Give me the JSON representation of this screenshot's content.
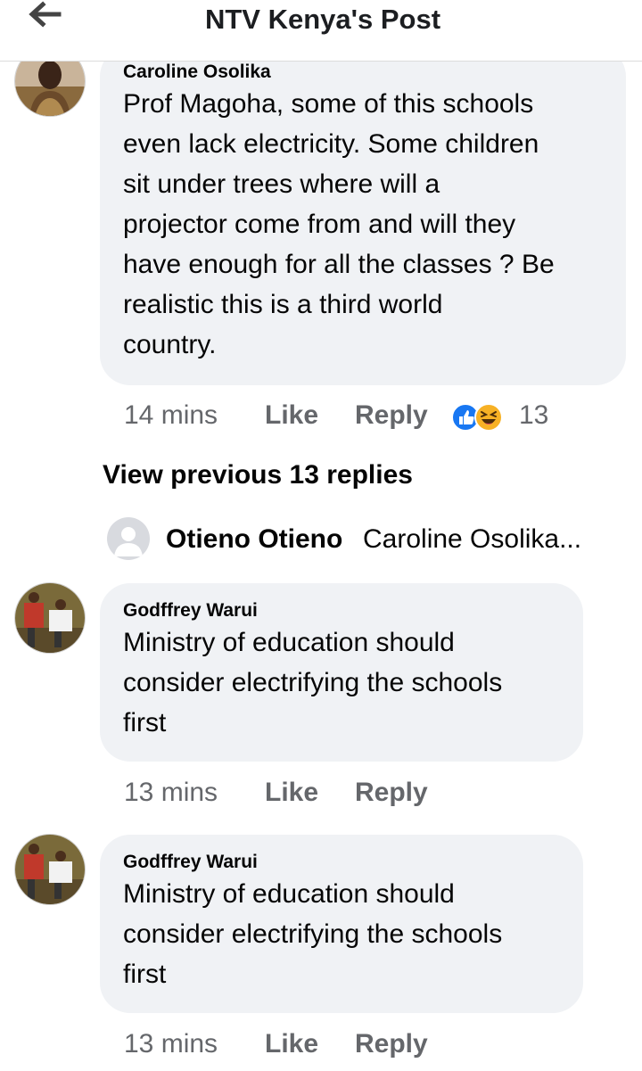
{
  "header": {
    "title": "NTV Kenya's Post",
    "back_icon": "arrow-left-icon"
  },
  "comments": [
    {
      "author": "Caroline Osolika",
      "lines": [
        "Prof Magoha, some of this schools",
        "even lack electricity. Some children",
        "sit under trees where will a",
        "projector come from and will they",
        "have enough for all the classes ? Be",
        "realistic this is a third world",
        "country."
      ],
      "time": "14 mins",
      "like_label": "Like",
      "reply_label": "Reply",
      "reactions": [
        "like-icon",
        "haha-icon"
      ],
      "reaction_count": "13"
    },
    {
      "author": "Godffrey Warui",
      "lines": [
        "Ministry of education should",
        "consider electrifying the schools",
        "first"
      ],
      "time": "13 mins",
      "like_label": "Like",
      "reply_label": "Reply"
    },
    {
      "author": "Godffrey Warui",
      "lines": [
        "Ministry of education should",
        "consider electrifying the schools",
        "first"
      ],
      "time": "13 mins",
      "like_label": "Like",
      "reply_label": "Reply"
    }
  ],
  "view_previous": "View previous 13 replies",
  "reply_preview": {
    "author": "Otieno Otieno",
    "text": "Caroline Osolika..."
  },
  "colors": {
    "bubble": "#f0f2f5",
    "meta_text": "#65676b",
    "like_blue": "#1877f2",
    "haha_yellow": "#f7b125"
  }
}
